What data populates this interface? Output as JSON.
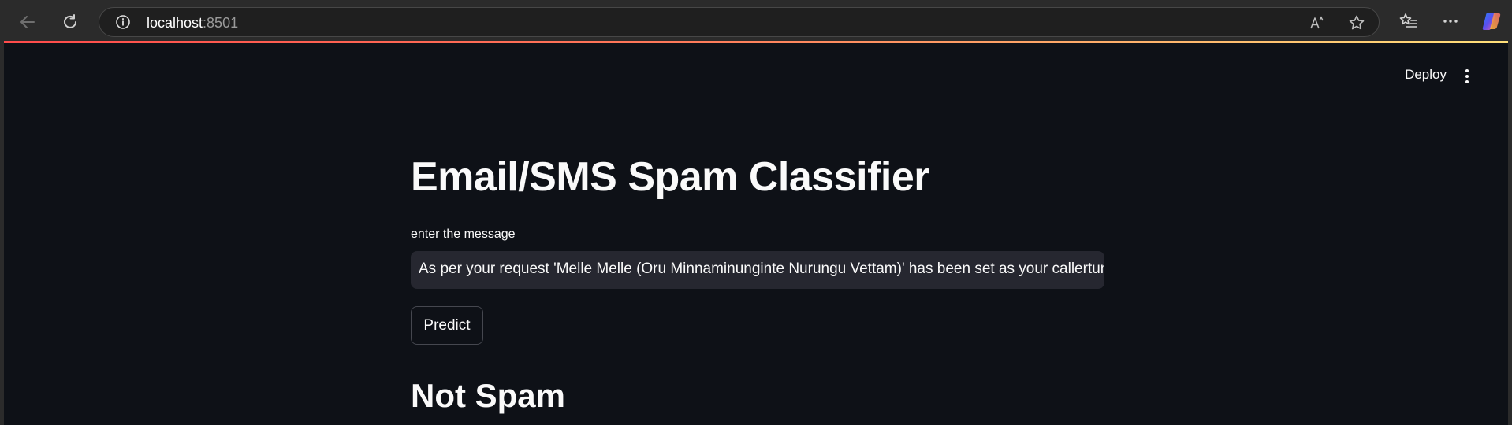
{
  "browser": {
    "url_host": "localhost",
    "url_port": ":8501"
  },
  "app": {
    "deploy_label": "Deploy",
    "title": "Email/SMS Spam Classifier",
    "input_label": "enter the message",
    "input_value": "As per your request 'Melle Melle (Oru Minnaminunginte Nurungu Vettam)' has been set as your callertun",
    "predict_label": "Predict",
    "result": "Not Spam"
  },
  "colors": {
    "background": "#0e1117",
    "input_bg": "#262730",
    "text": "#fafafa",
    "accent_gradient_start": "#ff4b4b",
    "accent_gradient_end": "#ffe07a"
  }
}
